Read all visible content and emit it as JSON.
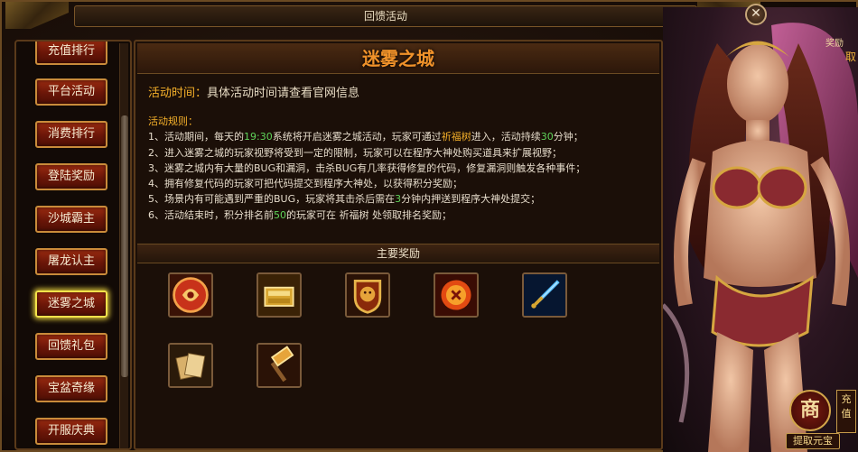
{
  "window": {
    "title": "回馈活动"
  },
  "top_right": {
    "label_partial": "奖励",
    "label_partial_2": "取"
  },
  "menu": {
    "items": [
      {
        "label": "充值排行",
        "active": false
      },
      {
        "label": "平台活动",
        "active": false
      },
      {
        "label": "消费排行",
        "active": false
      },
      {
        "label": "登陆奖励",
        "active": false
      },
      {
        "label": "沙城霸主",
        "active": false
      },
      {
        "label": "屠龙认主",
        "active": false
      },
      {
        "label": "迷雾之城",
        "active": true
      },
      {
        "label": "回馈礼包",
        "active": false
      },
      {
        "label": "宝盆奇缘",
        "active": false
      },
      {
        "label": "开服庆典",
        "active": false
      }
    ]
  },
  "event": {
    "title": "迷雾之城",
    "time_label": "活动时间：",
    "time_value": "具体活动时间请查看官网信息",
    "rules_title": "活动规则：",
    "rules": [
      {
        "pre": "1、活动期间，每天的",
        "num": "19:30",
        "mid": "系统将开启迷雾之城活动，玩家可通过",
        "npc": "祈福树",
        "mid2": "进入，活动持续",
        "num2": "30",
        "post": "分钟；"
      },
      {
        "pre": "2、进入迷雾之城的玩家视野将受到一定的限制，玩家可以在程序大神处购买道具来扩展视野；"
      },
      {
        "pre": "3、迷雾之城内有大量的BUG和漏洞，击杀BUG有几率获得修复的代码，修复漏洞则触发各种事件；"
      },
      {
        "pre": "4、拥有修复代码的玩家可把代码提交到程序大神处，以获得积分奖励；"
      },
      {
        "pre": "5、场景内有可能遇到严重的BUG，玩家将其击杀后需在",
        "num": "3",
        "post": "分钟内押送到程序大神处提交；"
      },
      {
        "pre": "6、活动结束时，积分排名前",
        "num": "50",
        "post": "的玩家可在 祈福树 处领取排名奖励；"
      }
    ],
    "rewards_title": "主要奖励",
    "rewards": [
      {
        "icon": "red-medallion-icon"
      },
      {
        "icon": "gold-ingot-chest-icon"
      },
      {
        "icon": "lion-shield-icon"
      },
      {
        "icon": "fire-rune-icon"
      },
      {
        "icon": "ice-sword-icon"
      },
      {
        "icon": "cards-scroll-icon"
      },
      {
        "icon": "golden-hammer-icon"
      }
    ]
  },
  "shop": {
    "badge": "商",
    "label": "提取元宝",
    "recharge": "充值"
  },
  "colors": {
    "accent": "#f0922a",
    "highlight_num": "#5fd35a",
    "label": "#f6b12a",
    "active_glow": "#f4e24a"
  }
}
